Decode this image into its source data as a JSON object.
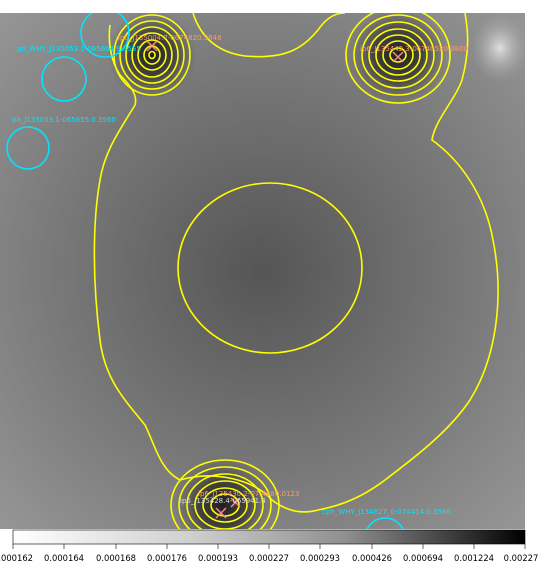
{
  "image": {
    "colormap": "grayscale (light = low, dark = high)",
    "contour_color": "#ffff00",
    "region_color": "#00e5ff",
    "marker_color": "#ff7f7f",
    "label_color": "#ff9a66"
  },
  "sources": {
    "top_left": {
      "label": "ip6_J135004.7-0674820.3848"
    },
    "top_right": {
      "label": "ip6_J135442.3-06740520.3800"
    },
    "bottom": {
      "label_a": "ip6_J135428.4-065941.4",
      "label_b": "ip6_J135430.2-07.4680.0123"
    }
  },
  "regions": {
    "r1": {
      "label": "ph_WHY_J135053.1-065604.9.3555"
    },
    "r2": {
      "label": "ph_J135053.1-065655.0.3560"
    },
    "r3": {
      "label": "cph_WHY_J134827_0-074414.0.3566"
    }
  },
  "colorbar": {
    "ticks": [
      "0.000162",
      "0.000164",
      "0.000168",
      "0.000176",
      "0.000193",
      "0.000227",
      "0.000293",
      "0.000426",
      "0.000694",
      "0.001224",
      "0.00227"
    ]
  }
}
